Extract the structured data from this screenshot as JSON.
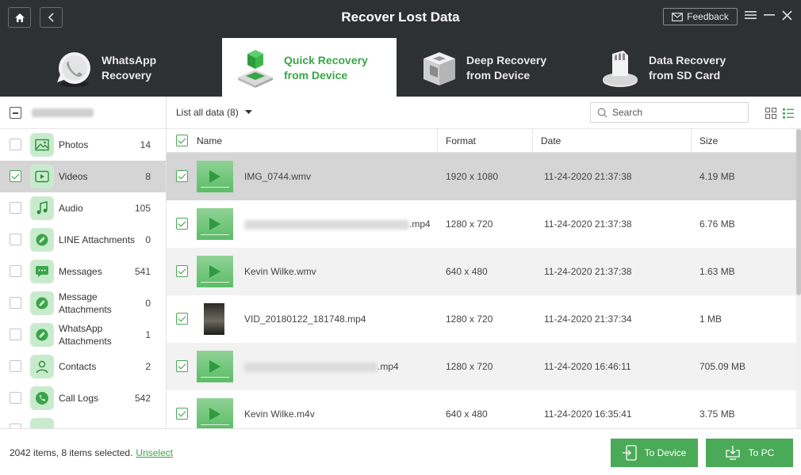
{
  "header": {
    "title": "Recover Lost Data",
    "feedback_label": "Feedback",
    "nav": {
      "home_icon": "home-icon",
      "back_icon": "back-arrow-icon"
    },
    "window_controls": [
      "menu-icon",
      "minimize-icon",
      "close-icon"
    ]
  },
  "tabs": [
    {
      "label": "WhatsApp\nRecovery",
      "icon": "whatsapp-icon",
      "active": false
    },
    {
      "label": "Quick Recovery\nfrom Device",
      "icon": "quick-recovery-icon",
      "active": true
    },
    {
      "label": "Deep Recovery\nfrom Device",
      "icon": "deep-recovery-icon",
      "active": false
    },
    {
      "label": "Data Recovery\nfrom SD Card",
      "icon": "sd-card-icon",
      "active": false
    }
  ],
  "sidebar": {
    "categories": [
      {
        "label": "Photos",
        "count": "14",
        "icon": "photo-icon",
        "checked": false
      },
      {
        "label": "Videos",
        "count": "8",
        "icon": "video-icon",
        "checked": true
      },
      {
        "label": "Audio",
        "count": "105",
        "icon": "music-note-icon",
        "checked": false
      },
      {
        "label": "LINE Attachments",
        "count": "0",
        "icon": "attachment-icon",
        "checked": false
      },
      {
        "label": "Messages",
        "count": "541",
        "icon": "message-icon",
        "checked": false
      },
      {
        "label": "Message\nAttachments",
        "count": "0",
        "icon": "attachment-icon",
        "checked": false
      },
      {
        "label": "WhatsApp\nAttachments",
        "count": "1",
        "icon": "attachment-icon",
        "checked": false
      },
      {
        "label": "Contacts",
        "count": "2",
        "icon": "contact-icon",
        "checked": false
      },
      {
        "label": "Call Logs",
        "count": "542",
        "icon": "phone-icon",
        "checked": false
      }
    ]
  },
  "toolbar": {
    "filter_label": "List all data (8)",
    "search_placeholder": "Search",
    "view_icons": [
      "grid-view-icon",
      "list-view-icon"
    ]
  },
  "table": {
    "headers": {
      "name": "Name",
      "format": "Format",
      "date": "Date",
      "size": "Size"
    },
    "rows": [
      {
        "name": "IMG_0744.wmv",
        "format": "1920 x 1080",
        "date": "11-24-2020 21:37:38",
        "size": "4.19 MB",
        "checked": true,
        "thumb": "video"
      },
      {
        "name": ".mp4",
        "format": "1280 x 720",
        "date": "11-24-2020 21:37:38",
        "size": "6.76 MB",
        "checked": true,
        "thumb": "video"
      },
      {
        "name": "Kevin Wilke.wmv",
        "format": "640 x 480",
        "date": "11-24-2020 21:37:38",
        "size": "1.63 MB",
        "checked": true,
        "thumb": "video"
      },
      {
        "name": "VID_20180122_181748.mp4",
        "format": "1280 x 720",
        "date": "11-24-2020 21:37:34",
        "size": "1 MB",
        "checked": true,
        "thumb": "photo"
      },
      {
        "name": ".mp4",
        "format": "1280 x 720",
        "date": "11-24-2020 16:46:11",
        "size": "705.09 MB",
        "checked": true,
        "thumb": "video"
      },
      {
        "name": "Kevin Wilke.m4v",
        "format": "640 x 480",
        "date": "11-24-2020 16:35:41",
        "size": "3.75 MB",
        "checked": true,
        "thumb": "video"
      }
    ]
  },
  "footer": {
    "status": "2042 items, 8 items selected.",
    "unselect": "Unselect",
    "to_device": "To Device",
    "to_pc": "To PC"
  },
  "colors": {
    "accent": "#4aaa58",
    "header_bg": "#2e3132",
    "selected_row": "#d5d5d5"
  }
}
